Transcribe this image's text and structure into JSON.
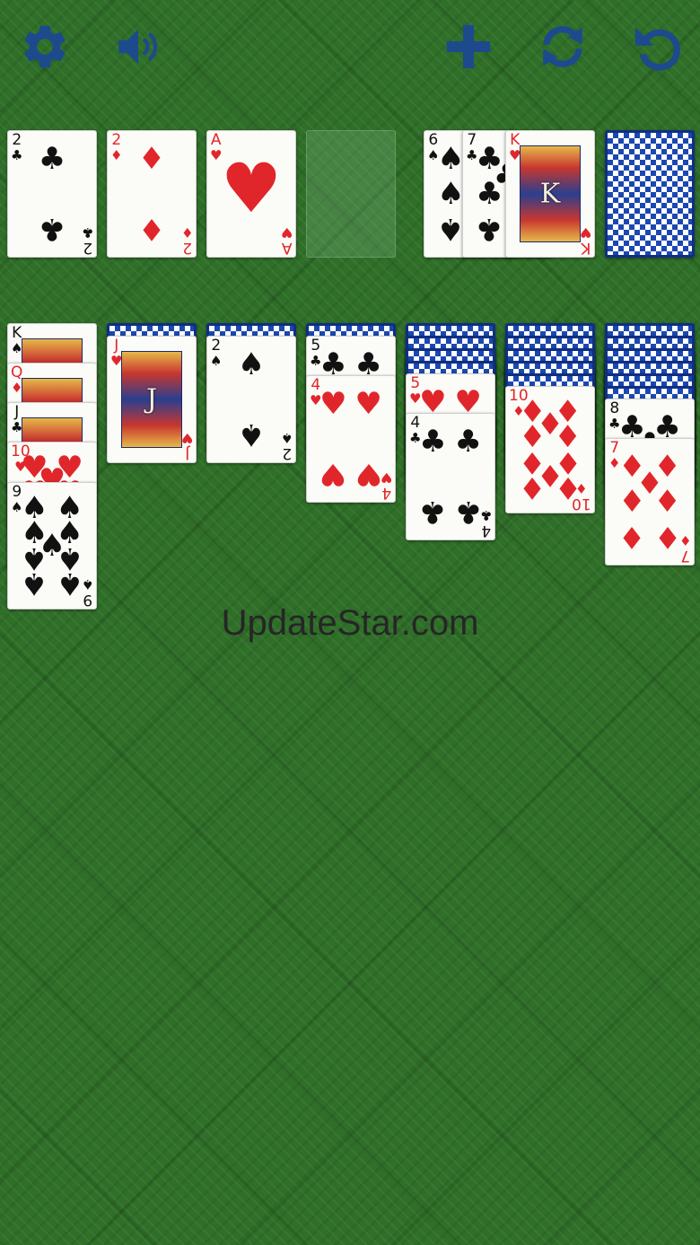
{
  "colors": {
    "toolbar_icon": "#1d4a8c",
    "felt": "#2f6f28",
    "card_back": "#1b48b0",
    "red_suit": "#e1262b",
    "black_suit": "#111111"
  },
  "toolbar": {
    "settings": {
      "icon": "gear-icon"
    },
    "sound": {
      "icon": "speaker-icon"
    },
    "new_game": {
      "icon": "plus-icon"
    },
    "restart": {
      "icon": "refresh-icon"
    },
    "undo": {
      "icon": "undo-icon"
    }
  },
  "foundations": [
    {
      "rank": "2",
      "suit": "♣",
      "color": "black"
    },
    {
      "rank": "2",
      "suit": "♦",
      "color": "red"
    },
    {
      "rank": "A",
      "suit": "♥",
      "color": "red"
    },
    null
  ],
  "waste": [
    {
      "rank": "6",
      "suit": "♠",
      "color": "black"
    },
    {
      "rank": "7",
      "suit": "♣",
      "color": "black"
    },
    {
      "rank": "K",
      "suit": "♥",
      "color": "red"
    }
  ],
  "stock": {
    "face_down": true
  },
  "tableau": [
    {
      "hidden": 0,
      "cards": [
        {
          "rank": "K",
          "suit": "♠",
          "color": "black"
        },
        {
          "rank": "Q",
          "suit": "♦",
          "color": "red"
        },
        {
          "rank": "J",
          "suit": "♣",
          "color": "black"
        },
        {
          "rank": "10",
          "suit": "♥",
          "color": "red"
        },
        {
          "rank": "9",
          "suit": "♠",
          "color": "black"
        }
      ]
    },
    {
      "hidden": 1,
      "cards": [
        {
          "rank": "J",
          "suit": "♥",
          "color": "red"
        }
      ]
    },
    {
      "hidden": 1,
      "cards": [
        {
          "rank": "2",
          "suit": "♠",
          "color": "black"
        }
      ]
    },
    {
      "hidden": 1,
      "cards": [
        {
          "rank": "5",
          "suit": "♣",
          "color": "black"
        },
        {
          "rank": "4",
          "suit": "♥",
          "color": "red"
        }
      ]
    },
    {
      "hidden": 4,
      "cards": [
        {
          "rank": "5",
          "suit": "♥",
          "color": "red"
        },
        {
          "rank": "4",
          "suit": "♣",
          "color": "black"
        }
      ]
    },
    {
      "hidden": 5,
      "cards": [
        {
          "rank": "10",
          "suit": "♦",
          "color": "red"
        }
      ]
    },
    {
      "hidden": 6,
      "cards": [
        {
          "rank": "8",
          "suit": "♣",
          "color": "black"
        },
        {
          "rank": "7",
          "suit": "♦",
          "color": "red"
        }
      ]
    }
  ],
  "watermark": "UpdateStar.com"
}
